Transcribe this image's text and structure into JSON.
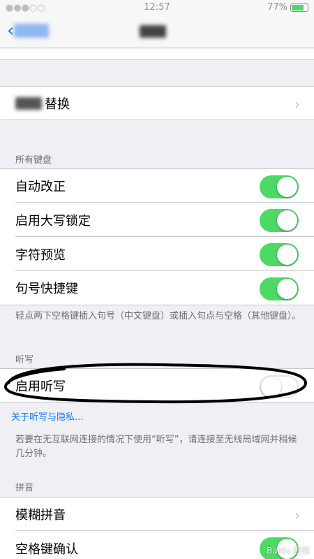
{
  "status": {
    "time": "12:57",
    "battery_percent": "77%",
    "battery_level": 0.77
  },
  "nav": {
    "back_label_blurred": "通用",
    "title_blurred": "键盘"
  },
  "replace_row": {
    "label": "替换",
    "blurred_prefix": "文本"
  },
  "all_keyboards": {
    "header": "所有键盘",
    "rows": [
      {
        "label": "自动改正",
        "on": true
      },
      {
        "label": "启用大写锁定",
        "on": true
      },
      {
        "label": "字符预览",
        "on": true
      },
      {
        "label": "句号快捷键",
        "on": true
      }
    ],
    "footer": "轻点两下空格键插入句号（中文键盘）或插入句点与空格（其他键盘）。"
  },
  "dictation": {
    "header": "听写",
    "row_label": "启用听写",
    "on": false,
    "privacy_link": "关于听写与隐私...",
    "footer": "若要在无互联网连接的情况下使用“听写”，请连接至无线局域网并稍候几分钟。"
  },
  "pinyin": {
    "header": "拼音",
    "rows": [
      {
        "label": "模糊拼音"
      },
      {
        "label": "空格键确认"
      }
    ]
  },
  "watermark": "Baidu 经验",
  "colors": {
    "toggle_on": "#4cd964",
    "link": "#0a7aff",
    "background": "#efeff4"
  }
}
